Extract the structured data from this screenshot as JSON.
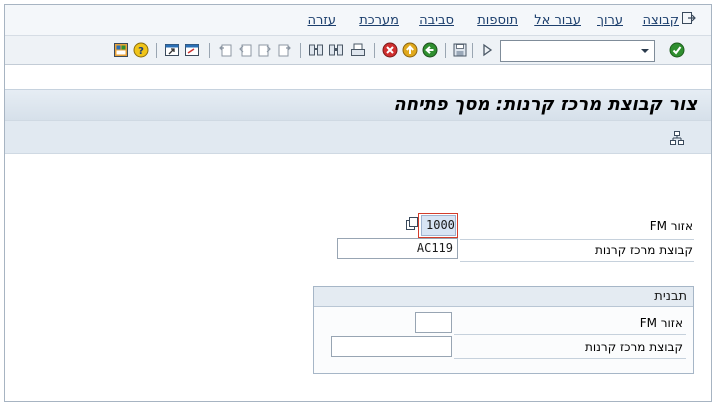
{
  "menu": {
    "items": [
      {
        "key": "group",
        "label": "קבוצה"
      },
      {
        "key": "edit",
        "label": "ערוך"
      },
      {
        "key": "goto",
        "label": "עבור אל"
      },
      {
        "key": "extras",
        "label": "תוספות"
      },
      {
        "key": "environment",
        "label": "סביבה"
      },
      {
        "key": "system",
        "label": "מערכת"
      },
      {
        "key": "help",
        "label": "עזרה"
      }
    ]
  },
  "toolbar": {
    "command_field": {
      "value": ""
    },
    "icons": [
      "enter-icon",
      "dropdown-icon",
      "play-icon",
      "save-icon",
      "back-icon",
      "exit-icon",
      "cancel-icon",
      "print-icon",
      "find-icon",
      "find-next-icon",
      "first-page-icon",
      "previous-page-icon",
      "next-page-icon",
      "last-page-icon",
      "create-session-icon",
      "shortcut-icon",
      "help-icon",
      "customize-layout-icon"
    ]
  },
  "page": {
    "title": "צור קבוצת מרכז קרנות: מסך פתיחה"
  },
  "fields": {
    "fm_area": {
      "label": "אזור FM",
      "value": "1000"
    },
    "fund_center_group": {
      "label": "קבוצת מרכז קרנות",
      "value": "AC119"
    }
  },
  "template": {
    "title": "תבנית",
    "fm_area": {
      "label": "אזור FM",
      "value": ""
    },
    "fund_center_group": {
      "label": "קבוצת מרכז קרנות",
      "value": ""
    }
  },
  "colors": {
    "title_bar": "#d6e0ea",
    "menu_text": "#1c3f6d",
    "required_border": "#d33c2b",
    "enter_green": "#2f8f2f"
  }
}
